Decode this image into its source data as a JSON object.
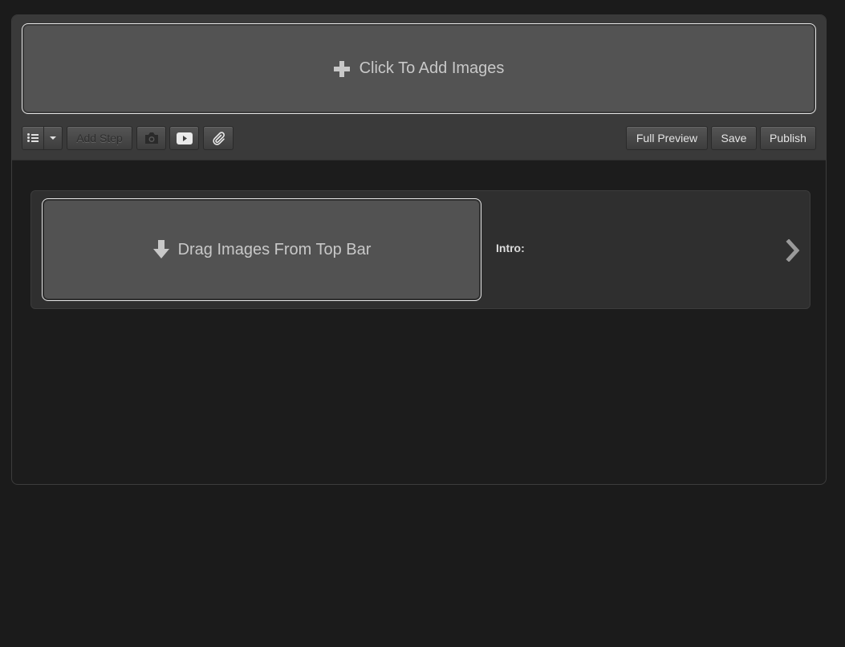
{
  "topbar": {
    "add_images_label": "Click To Add Images"
  },
  "toolbar": {
    "add_step_label": "Add Step",
    "full_preview_label": "Full Preview",
    "save_label": "Save",
    "publish_label": "Publish",
    "icons": [
      "list-icon",
      "chevron-down-icon",
      "camera-icon",
      "video-icon",
      "paperclip-icon"
    ]
  },
  "step": {
    "drop_zone_label": "Drag Images From Top Bar",
    "intro_label": "Intro:"
  },
  "colors": {
    "background": "#1b1b1b",
    "topbar": "#3a3a3a",
    "zone": "#535353",
    "card": "#2f2f2f"
  }
}
